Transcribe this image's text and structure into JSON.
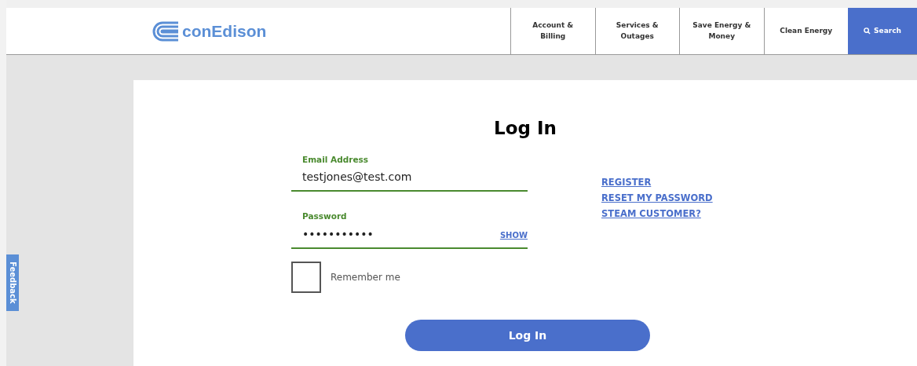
{
  "header": {
    "logo_text": "conEdison",
    "nav": [
      {
        "label": "Account &\nBilling"
      },
      {
        "label": "Services &\nOutages"
      },
      {
        "label": "Save Energy &\nMoney"
      },
      {
        "label": "Clean Energy"
      }
    ],
    "search": {
      "label": "Search"
    }
  },
  "feedback": "Feedback",
  "login": {
    "title": "Log In",
    "email": {
      "label": "Email Address",
      "value": "testjones@test.com"
    },
    "password": {
      "label": "Password",
      "value": "•••••••••••",
      "show": "SHOW"
    },
    "remember": {
      "label": "Remember me",
      "checked": false
    },
    "links": [
      "REGISTER",
      "RESET MY PASSWORD",
      "STEAM CUSTOMER?"
    ],
    "submit": "Log In"
  }
}
